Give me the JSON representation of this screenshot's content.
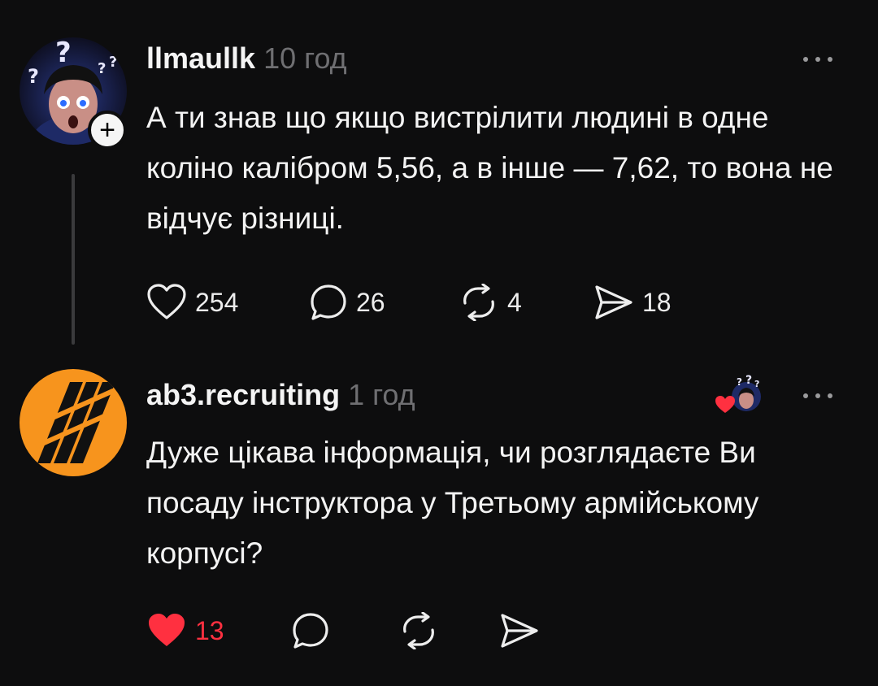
{
  "posts": [
    {
      "username": "llmaullk",
      "time": "10 год",
      "text": "А ти знав що якщо вистрілити людині в одне коліно калібром 5,56, а в інше — 7,62, то вона не відчує різниці.",
      "likes": "254",
      "comments": "26",
      "reposts": "4",
      "shares": "18",
      "avatar_icon": "scared-boy-question-marks-avatar",
      "follow_badge": "+"
    },
    {
      "username": "ab3.recruiting",
      "time": "1 год",
      "text": "Дуже цікава інформація, чи розглядаєте Ви посаду інструктора у Третьому армійському корпусі?",
      "likes": "13",
      "liked": true,
      "avatar_icon": "third-army-corps-logo",
      "liked_by_author_icon": "author-avatar-heart-badge"
    }
  ],
  "colors": {
    "background": "#0d0d0e",
    "text": "#f3f3f3",
    "muted": "#6f6f72",
    "like_red": "#ff3040",
    "brand_orange": "#f7941d"
  }
}
